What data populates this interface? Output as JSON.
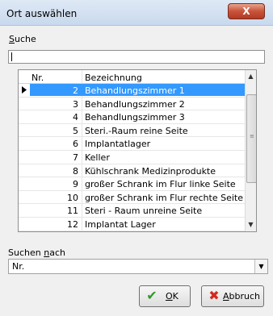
{
  "window": {
    "title": "Ort auswählen",
    "close_glyph": "X"
  },
  "search": {
    "label": "Suche",
    "value": ""
  },
  "grid": {
    "columns": [
      "Nr.",
      "Bezeichnung"
    ],
    "rows": [
      {
        "nr": "2",
        "bez": "Behandlungszimmer 1",
        "selected": true
      },
      {
        "nr": "3",
        "bez": "Behandlungszimmer 2"
      },
      {
        "nr": "4",
        "bez": "Behandlungszimmer 3"
      },
      {
        "nr": "5",
        "bez": "Steri.-Raum reine Seite"
      },
      {
        "nr": "6",
        "bez": "Implantatlager"
      },
      {
        "nr": "7",
        "bez": "Keller"
      },
      {
        "nr": "8",
        "bez": "Kühlschrank Medizinprodukte"
      },
      {
        "nr": "9",
        "bez": "großer Schrank im Flur linke Seite"
      },
      {
        "nr": "10",
        "bez": "großer Schrank im Flur rechte Seite"
      },
      {
        "nr": "11",
        "bez": "Steri - Raum unreine Seite"
      },
      {
        "nr": "12",
        "bez": "Implantat Lager"
      }
    ]
  },
  "search_by": {
    "label": "Suchen nach",
    "value": "Nr."
  },
  "buttons": {
    "ok": "OK",
    "cancel": "Abbruch"
  },
  "icons": {
    "row_indicator": "triangle-right-icon",
    "ok": "checkmark-icon",
    "cancel": "x-icon"
  }
}
